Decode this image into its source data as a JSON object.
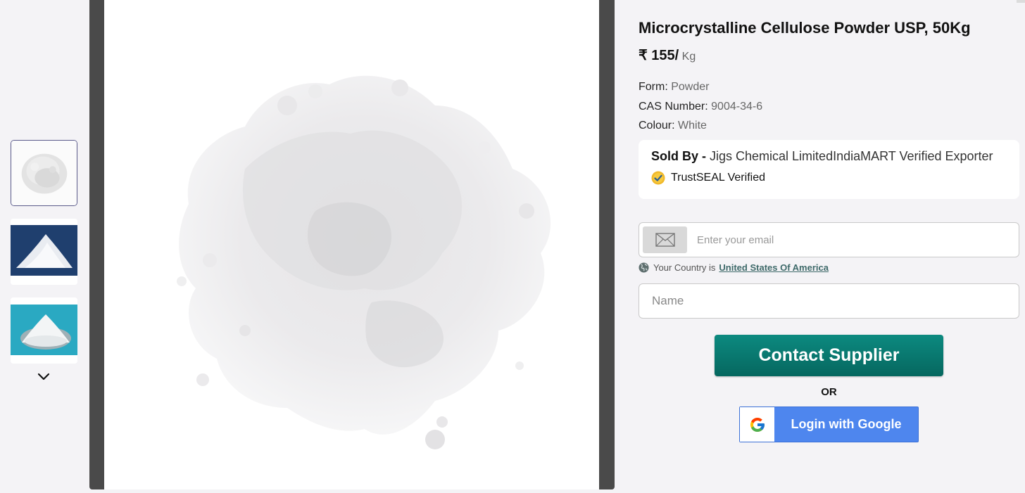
{
  "product": {
    "title": "Microcrystalline Cellulose Powder USP, 50Kg",
    "price": "₹ 155/",
    "unit": "Kg",
    "specs": [
      {
        "key": "Form: ",
        "value": "Powder"
      },
      {
        "key": "CAS Number: ",
        "value": "9004-34-6"
      },
      {
        "key": "Colour: ",
        "value": "White"
      }
    ]
  },
  "gallery": {
    "thumbnails": [
      {
        "name": "powder-pile-white",
        "active": true
      },
      {
        "name": "powder-pile-blue-background",
        "active": false
      },
      {
        "name": "powder-pile-teal-background",
        "active": false
      }
    ],
    "more_icon": "chevron-down-icon"
  },
  "seller": {
    "label": "Sold By - ",
    "name": "Jigs Chemical LimitedIndiaMART Verified Exporter",
    "trust_text": "TrustSEAL Verified"
  },
  "form": {
    "email_placeholder": "Enter your email",
    "country_prefix": "Your Country is",
    "country": "United States Of America",
    "name_placeholder": "Name",
    "contact_button": "Contact Supplier",
    "or_text": "OR",
    "google_button": "Login with Google"
  },
  "colors": {
    "contact_button": "#0a7d74",
    "google_button": "#4e86ee",
    "country_link": "#3f6a6a",
    "viewer_frame": "#4a4a4a"
  }
}
